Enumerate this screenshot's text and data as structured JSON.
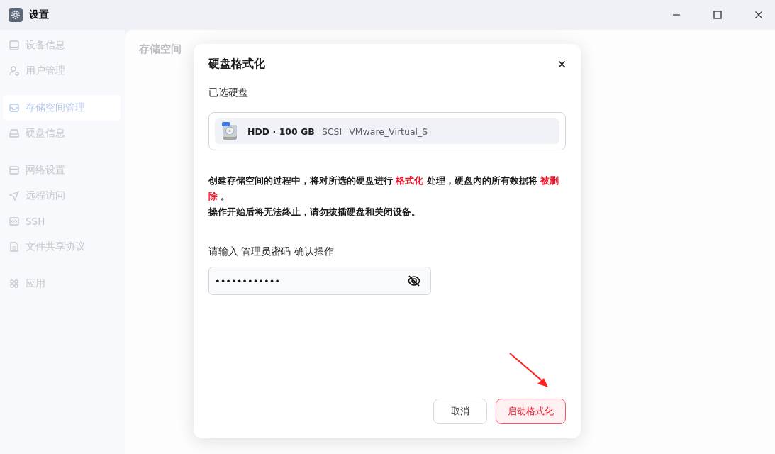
{
  "window": {
    "title": "设置"
  },
  "sidebar": {
    "groups": [
      [
        {
          "label": "设备信息",
          "kind": "device",
          "selected": false
        },
        {
          "label": "用户管理",
          "kind": "user",
          "selected": false
        }
      ],
      [
        {
          "label": "存储空间管理",
          "kind": "storage",
          "selected": true
        },
        {
          "label": "硬盘信息",
          "kind": "disk",
          "selected": false
        }
      ],
      [
        {
          "label": "网络设置",
          "kind": "network",
          "selected": false
        },
        {
          "label": "远程访问",
          "kind": "remote",
          "selected": false
        },
        {
          "label": "SSH",
          "kind": "ssh",
          "selected": false
        },
        {
          "label": "文件共享协议",
          "kind": "file",
          "selected": false
        }
      ],
      [
        {
          "label": "应用",
          "kind": "apps",
          "selected": false
        }
      ]
    ]
  },
  "page": {
    "title": "存储空间"
  },
  "dialog": {
    "title": "硬盘格式化",
    "selected_label": "已选硬盘",
    "disk": {
      "name": "HDD · 100 GB",
      "bus": "SCSI",
      "model": "VMware_Virtual_S"
    },
    "warning": [
      "创建存储空间的过程中，将对所选的硬盘进行 **格式化** 处理，硬盘内的所有数据将 **被删除** 。",
      "操作开始后将无法终止，请勿拔插硬盘和关闭设备。"
    ],
    "password_label": "请输入 管理员密码 确认操作",
    "password": {
      "value": "••••••••••••"
    },
    "buttons": [
      {
        "label": "取消",
        "kind": "secondary"
      },
      {
        "label": "启动格式化",
        "kind": "danger"
      }
    ]
  }
}
